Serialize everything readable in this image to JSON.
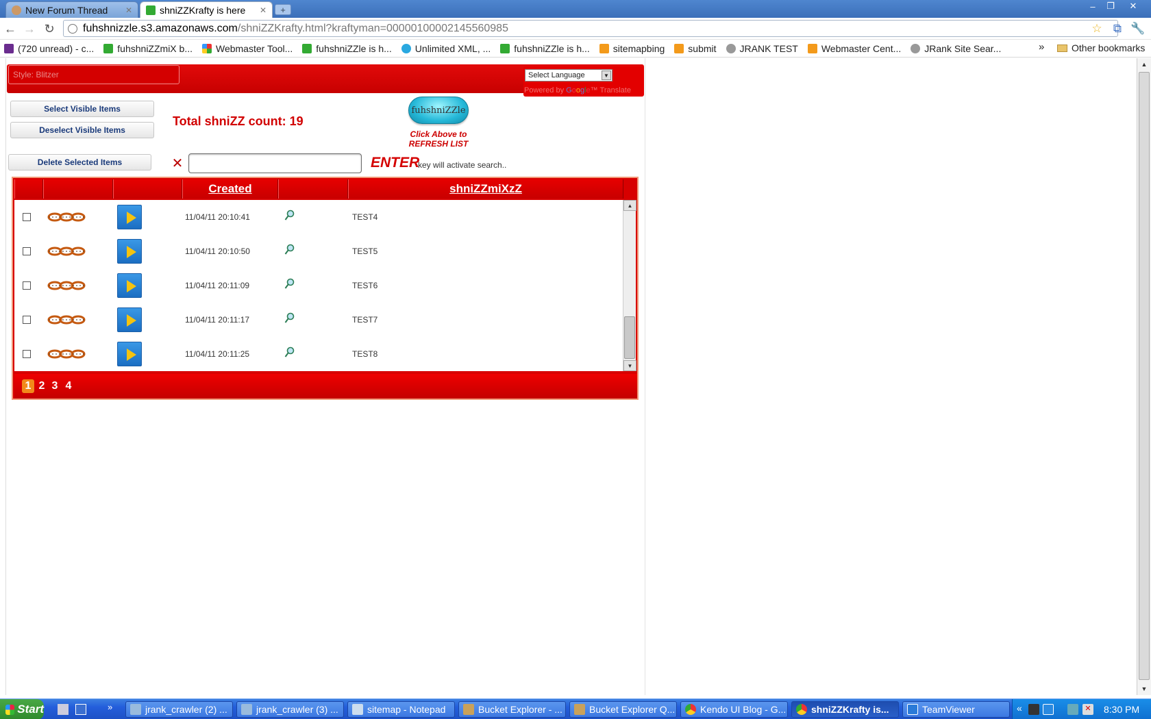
{
  "browser": {
    "tabs": [
      {
        "title": "New Forum Thread",
        "active": false
      },
      {
        "title": "shniZZKrafty is here",
        "active": true
      }
    ],
    "url_host": "fuhshnizzle.s3.amazonaws.com",
    "url_path": "/shniZZKrafty.html?kraftyman=000001000021455609​85",
    "bookmarks": [
      "(720 unread) - c...",
      "fuhshniZZmiX b...",
      "Webmaster Tool...",
      "fuhshniZZle is h...",
      "Unlimited XML, ...",
      "fuhshniZZle is h...",
      "sitemapbing",
      "submit",
      "JRANK TEST",
      "Webmaster Cent...",
      "JRank Site Sear..."
    ],
    "bookmarks_more": "»",
    "other_bookmarks": "Other bookmarks"
  },
  "page": {
    "style_label": "Style: Blitzer",
    "language_select": "Select Language",
    "powered_by": "Powered by",
    "google": [
      "G",
      "o",
      "o",
      "g",
      "l",
      "e"
    ],
    "translate": "Translate",
    "select_visible": "Select Visible Items",
    "deselect_visible": "Deselect Visible Items",
    "delete_selected": "Delete Selected Items",
    "total_count": "Total shniZZ count: 19",
    "logo_text": "fuhshniZZle",
    "refresh_caption_1": "Click Above to",
    "refresh_caption_2": "REFRESH LIST",
    "search_value": "",
    "enter_label": "ENTER",
    "enter_hint": "key will activate search..",
    "columns": [
      "",
      "",
      "",
      "Created",
      "",
      "shniZZmiXzZ"
    ],
    "rows": [
      {
        "created": "11/04/11 20:10:41",
        "name": "TEST4",
        "checked": false
      },
      {
        "created": "11/04/11 20:10:50",
        "name": "TEST5",
        "checked": false
      },
      {
        "created": "11/04/11 20:11:09",
        "name": "TEST6",
        "checked": false
      },
      {
        "created": "11/04/11 20:11:17",
        "name": "TEST7",
        "checked": false
      },
      {
        "created": "11/04/11 20:11:25",
        "name": "TEST8",
        "checked": false
      }
    ],
    "pages": [
      "1",
      "2",
      "3",
      "4"
    ],
    "current_page": "1"
  },
  "taskbar": {
    "start": "Start",
    "quicklaunch_more": "»",
    "tasks": [
      {
        "title": "jrank_crawler (2) ...",
        "active": false
      },
      {
        "title": "jrank_crawler (3) ...",
        "active": false
      },
      {
        "title": "sitemap - Notepad",
        "active": false
      },
      {
        "title": "Bucket Explorer - ...",
        "active": false
      },
      {
        "title": "Bucket Explorer Q...",
        "active": false
      },
      {
        "title": "Kendo UI Blog - G...",
        "active": false
      },
      {
        "title": "shniZZKrafty is...",
        "active": true
      },
      {
        "title": "TeamViewer",
        "active": false
      }
    ],
    "tray_expand": "«",
    "clock": "8:30 PM"
  },
  "colors": {
    "brand_red": "#d70000",
    "accent_orange": "#f28a1a",
    "play_blue": "#1b6ec2",
    "xp_blue": "#245edb"
  },
  "icons": {
    "chain": "chain-link-icon",
    "play": "play-icon",
    "details": "magnifier-icon",
    "clear": "clear-x-icon"
  }
}
